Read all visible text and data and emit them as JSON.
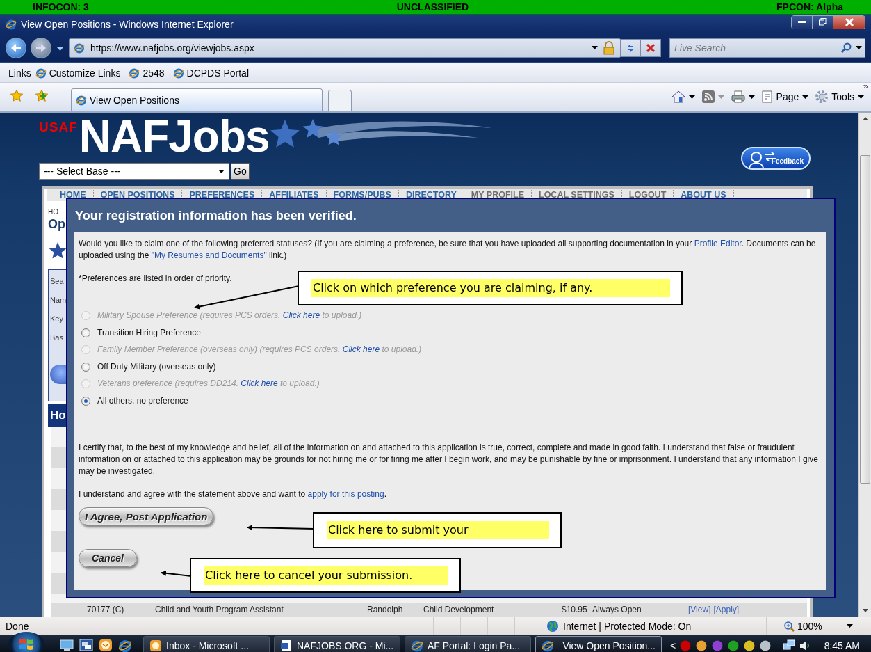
{
  "classification_bar": {
    "infocon": "INFOCON: 3",
    "classification": "UNCLASSIFIED",
    "fpcon": "FPCON: Alpha"
  },
  "window": {
    "title": "View Open Positions - Windows Internet Explorer"
  },
  "address_bar": {
    "url": "https://www.nafjobs.org/viewjobs.aspx",
    "search_placeholder": "Live Search"
  },
  "links_bar": {
    "label": "Links",
    "links": [
      "Customize Links",
      "2548",
      "DCPDS Portal"
    ]
  },
  "tabs": [
    {
      "label": "View Open Positions",
      "selected": true
    }
  ],
  "command_bar": {
    "page": "Page",
    "tools": "Tools",
    "more": "»"
  },
  "site": {
    "logo_tag": "USAF",
    "logo": "NAFJobs",
    "base_select": "--- Select Base ---",
    "go": "Go",
    "feedback": "Feedback",
    "nav": [
      {
        "label": "HOME",
        "dimmed": false
      },
      {
        "label": "OPEN POSITIONS",
        "dimmed": false
      },
      {
        "label": "PREFERENCES",
        "dimmed": false
      },
      {
        "label": "AFFILIATES",
        "dimmed": false
      },
      {
        "label": "FORMS/PUBS",
        "dimmed": false
      },
      {
        "label": "DIRECTORY",
        "dimmed": false
      },
      {
        "label": "MY PROFILE",
        "dimmed": true
      },
      {
        "label": "LOCAL SETTINGS",
        "dimmed": true
      },
      {
        "label": "LOGOUT",
        "dimmed": true
      },
      {
        "label": "ABOUT US",
        "dimmed": false
      }
    ],
    "breadcrumb": "HO",
    "heading": "Op",
    "search_labels": [
      "Sea",
      "Nam",
      "Key",
      "Bas"
    ],
    "section_bar": "Ho",
    "job_rows": [
      {
        "cells": [
          "70177 (C)",
          "Child and Youth Program Assistant",
          "Randolph",
          "Child Development",
          "$10.95",
          "Always Open"
        ],
        "links": [
          "[View]",
          "[Apply]"
        ]
      }
    ]
  },
  "dialog": {
    "title": "Your registration information has been verified.",
    "intro": {
      "text": "Would you like to claim one of the following preferred statuses? (If you are claiming a preference, be sure that you have uploaded all supporting documentation in your ",
      "link": "Profile Editor",
      "text2": ". Documents can be uploaded using the ",
      "link2": "\"My Resumes and Documents\"",
      "text3": " link.)"
    },
    "note": "*Preferences are listed in order of priority.",
    "options": [
      {
        "label": "Military Spouse Preference (requires PCS orders. ",
        "link": "Click here",
        "suffix": " to upload.)",
        "disabled": true,
        "selected": false
      },
      {
        "label": "Transition Hiring Preference",
        "disabled": false,
        "selected": false
      },
      {
        "label": "Family Member Preference (overseas only) (requires PCS orders. ",
        "link": "Click here",
        "suffix": " to upload.)",
        "disabled": true,
        "selected": false
      },
      {
        "label": "Off Duty Military (overseas only)",
        "disabled": false,
        "selected": false
      },
      {
        "label": "Veterans preference (requires DD214. ",
        "link": "Click here",
        "suffix": " to upload.)",
        "disabled": true,
        "selected": false
      },
      {
        "label": "All others, no preference",
        "disabled": false,
        "selected": true
      }
    ],
    "certification": "I certify that, to the best of my knowledge and belief, all of the information on and attached to this application is true, correct, complete and made in good faith. I understand that false or fraudulent information on or attached to this application may be grounds for not hiring me or for firing me after I begin work, and may be punishable by fine or imprisonment. I understand that any information I give may be investigated.",
    "agree": {
      "text": "I understand and agree with the statement above and want to ",
      "link": "apply for this posting",
      "suffix": "."
    },
    "buttons": [
      {
        "label": "I Agree, Post Application"
      },
      {
        "label": "Cancel"
      }
    ],
    "callouts": [
      "Click on which preference you are claiming, if any.",
      "Click here to submit your",
      "Click here to cancel your submission."
    ]
  },
  "status_bar": {
    "text": "Done",
    "zone": "Internet | Protected Mode: On",
    "zoom": "100%"
  },
  "taskbar": {
    "items": [
      {
        "label": "Inbox - Microsoft ...",
        "kind": "mail",
        "selected": false
      },
      {
        "label": "NAFJOBS.ORG - Mi...",
        "kind": "document",
        "selected": false
      },
      {
        "label": "AF Portal: Login Pa...",
        "kind": "browser",
        "selected": false
      },
      {
        "label": "View Open Position...",
        "kind": "browser",
        "selected": true
      }
    ],
    "tray_expand": "<",
    "time": "8:45 AM"
  }
}
